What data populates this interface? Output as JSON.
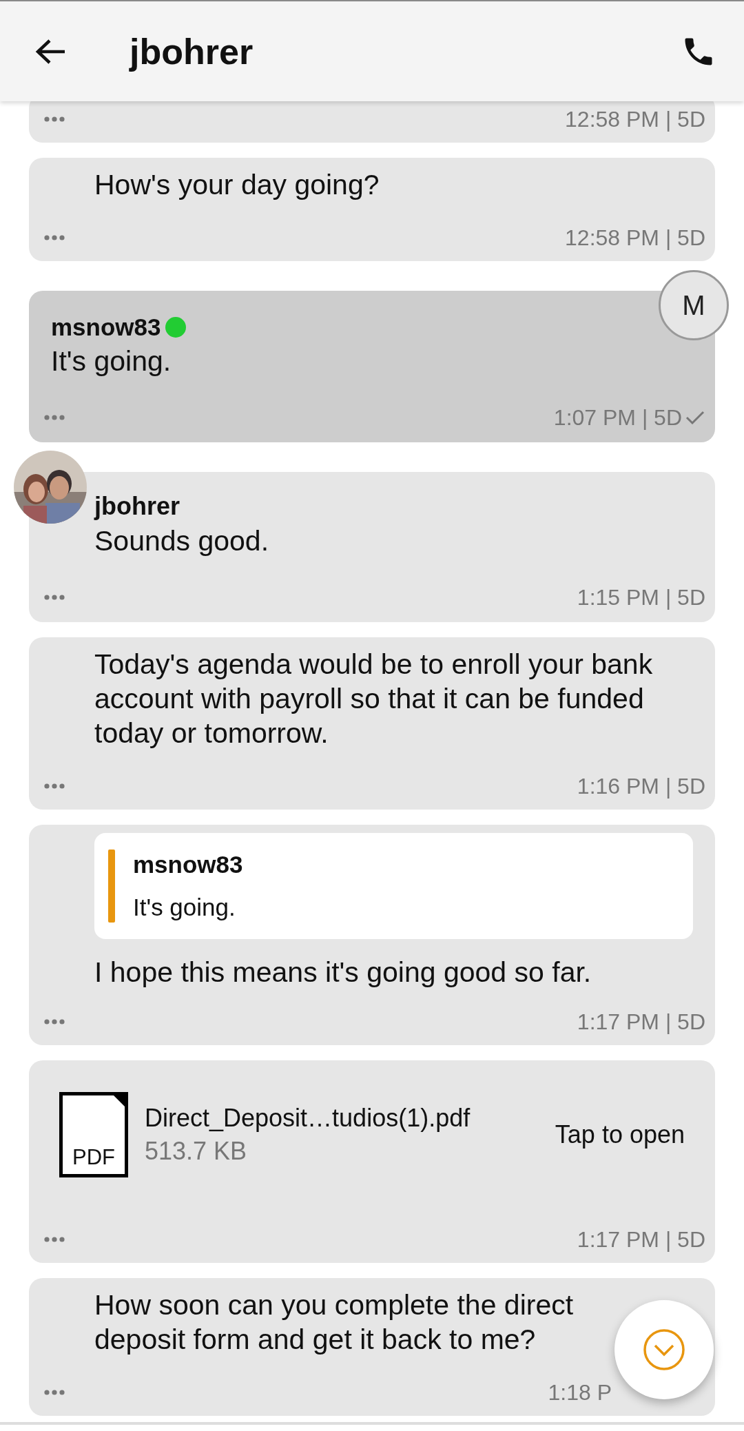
{
  "header": {
    "title": "jbohrer"
  },
  "messages": [
    {
      "kind": "partial",
      "time": "12:58 PM | 5D"
    },
    {
      "kind": "text",
      "text": "How's your day going?",
      "time": "12:58 PM | 5D"
    },
    {
      "kind": "own",
      "sender": "msnow83",
      "online": true,
      "avatar_initial": "M",
      "text": "It's going.",
      "time": "1:07 PM | 5D",
      "delivered": true
    },
    {
      "kind": "named",
      "sender": "jbohrer",
      "text": "Sounds good.",
      "time": "1:15 PM | 5D"
    },
    {
      "kind": "text",
      "text": "Today's agenda would be to enroll your bank account with payroll so that it can be funded today or tomorrow.",
      "time": "1:16 PM | 5D"
    },
    {
      "kind": "quote",
      "quote_sender": "msnow83",
      "quote_text": "It's going.",
      "text": "I hope this means it's going good so far.",
      "time": "1:17 PM | 5D"
    },
    {
      "kind": "file",
      "file_type": "PDF",
      "file_name": "Direct_Deposit…tudios(1).pdf",
      "file_size": "513.7 KB",
      "action": "Tap to open",
      "time": "1:17 PM | 5D"
    },
    {
      "kind": "text",
      "text": "How soon can you complete the direct deposit form and get it back to me?",
      "time": "1:18 P"
    }
  ]
}
